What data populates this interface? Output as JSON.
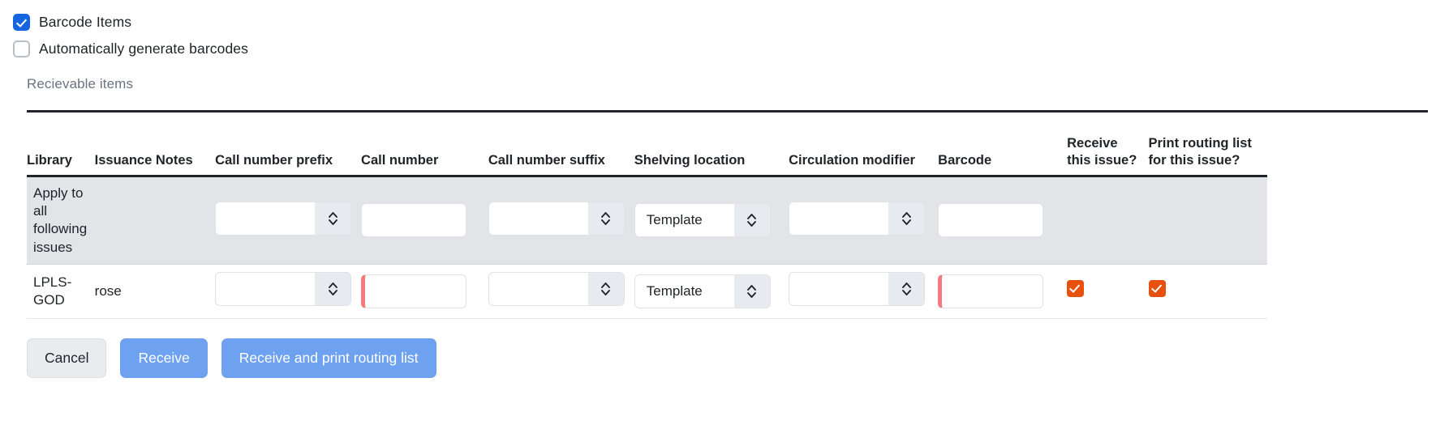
{
  "checkboxes": [
    {
      "label": "Barcode Items",
      "checked": true,
      "name": "barcode-items"
    },
    {
      "label": "Automatically generate barcodes",
      "checked": false,
      "name": "auto-generate-barcodes"
    }
  ],
  "section": {
    "title": "Recievable items"
  },
  "table": {
    "headers": {
      "library": "Library",
      "issuance_notes": "Issuance Notes",
      "call_number_prefix": "Call number prefix",
      "call_number": "Call number",
      "call_number_suffix": "Call number suffix",
      "shelving_location": "Shelving location",
      "circulation_modifier": "Circulation modifier",
      "barcode": "Barcode",
      "receive_this_issue": "Receive this issue?",
      "print_routing_list": "Print routing list for this issue?"
    },
    "rows": [
      {
        "type": "apply-all",
        "library": "Apply to all following issues",
        "issuance_notes": "",
        "call_number_prefix": "",
        "call_number": "",
        "call_number_suffix": "",
        "shelving_location": "Template",
        "circulation_modifier": "",
        "barcode": "",
        "receive_this_issue": null,
        "print_routing_list": null
      },
      {
        "type": "item",
        "library": "LPLS-GOD",
        "issuance_notes": "rose",
        "call_number_prefix": "",
        "call_number": "",
        "call_number_suffix": "",
        "shelving_location": "Template",
        "circulation_modifier": "",
        "barcode": "",
        "receive_this_issue": true,
        "print_routing_list": true
      }
    ]
  },
  "buttons": {
    "cancel": "Cancel",
    "receive": "Receive",
    "receive_print": "Receive and print routing list"
  },
  "colors": {
    "checkbox_blue": "#1565e0",
    "checkbox_orange": "#e8500f",
    "primary_button": "#6ea1ef",
    "error_border": "#f7797f",
    "apply_row_bg": "#e2e4e7"
  }
}
